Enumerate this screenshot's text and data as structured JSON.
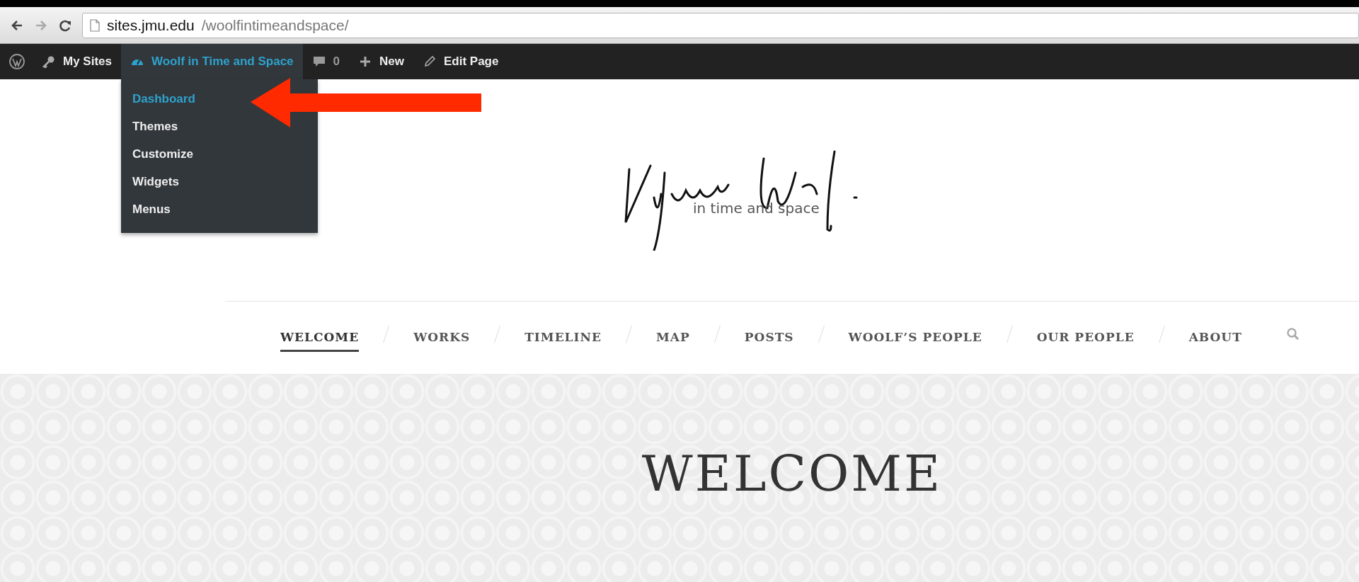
{
  "browser": {
    "url_host": "sites.jmu.edu",
    "url_path": "/woolfintimeandspace/"
  },
  "admin_bar": {
    "items": [
      {
        "kind": "mysites",
        "label": "My Sites",
        "selected": false
      },
      {
        "kind": "site",
        "label": "Woolf in Time and Space",
        "selected": true
      },
      {
        "kind": "comments",
        "label": "0",
        "selected": false
      },
      {
        "kind": "new",
        "label": "New",
        "selected": false
      },
      {
        "kind": "edit",
        "label": "Edit Page",
        "selected": false
      }
    ]
  },
  "site_menu": [
    {
      "label": "Dashboard",
      "selected": true
    },
    {
      "label": "Themes",
      "selected": false
    },
    {
      "label": "Customize",
      "selected": false
    },
    {
      "label": "Widgets",
      "selected": false
    },
    {
      "label": "Menus",
      "selected": false
    }
  ],
  "logo": {
    "tagline": "in time and space"
  },
  "nav": [
    {
      "label": "WELCOME",
      "selected": true
    },
    {
      "label": "WORKS",
      "selected": false
    },
    {
      "label": "TIMELINE",
      "selected": false
    },
    {
      "label": "MAP",
      "selected": false
    },
    {
      "label": "POSTS",
      "selected": false
    },
    {
      "label": "WOOLF’S PEOPLE",
      "selected": false
    },
    {
      "label": "OUR PEOPLE",
      "selected": false
    },
    {
      "label": "ABOUT",
      "selected": false
    }
  ],
  "hero": {
    "title": "WELCOME"
  }
}
